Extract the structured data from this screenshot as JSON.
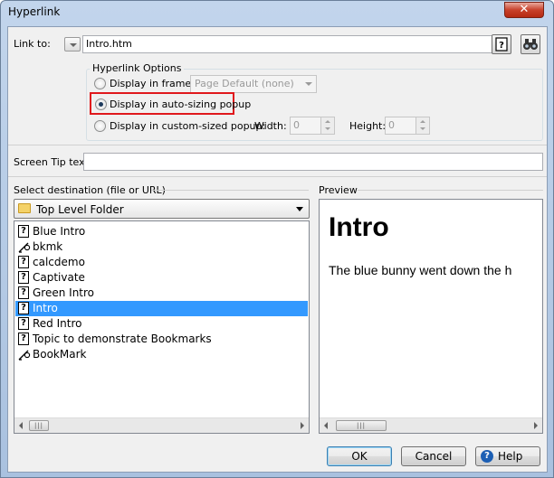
{
  "window": {
    "title": "Hyperlink",
    "close_glyph": "✕"
  },
  "link_to": {
    "label": "Link to:",
    "value": "Intro.htm",
    "icon_help": "?",
    "icon_browse": "binoculars-icon"
  },
  "hyperlink_options": {
    "legend": "Hyperlink Options",
    "display_in_frame_label": "Display in frame:",
    "frame_value": "Page Default (none)",
    "auto_sizing_label": "Display in auto-sizing popup",
    "custom_sized_label": "Display in custom-sized popup:",
    "width_label": "Width:",
    "width_value": "0",
    "height_label": "Height:",
    "height_value": "0",
    "selected": "auto-sizing"
  },
  "screen_tip": {
    "label": "Screen Tip text:",
    "value": ""
  },
  "destination": {
    "label": "Select destination (file or URL)",
    "folder": "Top Level Folder",
    "items": [
      {
        "type": "topic",
        "label": "Blue Intro"
      },
      {
        "type": "bookmark",
        "label": "bkmk"
      },
      {
        "type": "topic",
        "label": "calcdemo"
      },
      {
        "type": "topic",
        "label": "Captivate"
      },
      {
        "type": "topic",
        "label": "Green Intro"
      },
      {
        "type": "topic",
        "label": "Intro",
        "selected": true
      },
      {
        "type": "topic",
        "label": "Red Intro"
      },
      {
        "type": "topic",
        "label": "Topic to demonstrate Bookmarks"
      },
      {
        "type": "bookmark",
        "label": "BookMark"
      }
    ],
    "scroll_grip": "|||"
  },
  "preview": {
    "label": "Preview",
    "heading": "Intro",
    "body": "The blue bunny went down the h"
  },
  "buttons": {
    "ok": "OK",
    "cancel": "Cancel",
    "help": "Help",
    "help_icon": "?"
  },
  "colors": {
    "highlight_box": "#e0181c",
    "selection": "#3399ff"
  }
}
